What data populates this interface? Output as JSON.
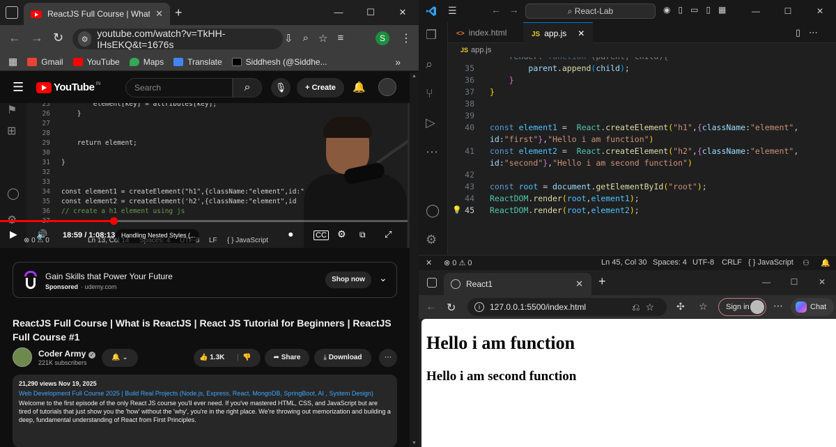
{
  "chrome": {
    "tab_title": "ReactJS Full Course | What is Re",
    "url": "youtube.com/watch?v=TkHH-IHsEKQ&t=1676s",
    "profile_initial": "S",
    "bookmarks": [
      {
        "label": "Gmail",
        "color": "#ea4335"
      },
      {
        "label": "YouTube",
        "color": "#ff0000"
      },
      {
        "label": "Maps",
        "color": "#34a853"
      },
      {
        "label": "Translate",
        "color": "#4285f4"
      },
      {
        "label": "Siddhesh (@Siddhe...",
        "color": "#000000"
      }
    ]
  },
  "youtube": {
    "logo_text": "YouTube",
    "logo_country": "IN",
    "search_placeholder": "Search",
    "create_label": "+ Create",
    "video": {
      "code_lines": [
        {
          "n": "25",
          "t": "        element[key] = attributes[key];"
        },
        {
          "n": "26",
          "t": "    }"
        },
        {
          "n": "27",
          "t": ""
        },
        {
          "n": "28",
          "t": ""
        },
        {
          "n": "29",
          "t": "    return element;"
        },
        {
          "n": "30",
          "t": ""
        },
        {
          "n": "31",
          "t": "}"
        },
        {
          "n": "32",
          "t": ""
        },
        {
          "n": "33",
          "t": ""
        },
        {
          "n": "34",
          "t": "const element1 = createElement(\"h1\",{className:\"element\",id:\""
        },
        {
          "n": "35",
          "t": "const element2 = createElement('h2',{className:\"element\",id"
        },
        {
          "n": "36",
          "t": "// create a h1 element using js"
        },
        {
          "n": "37",
          "t": ""
        }
      ],
      "time": "18:59 / 1:08:13",
      "chapter": "Handling Nested Styles (...",
      "progress": 0.278,
      "status_items": [
        "⊗ 0 ⚠ 0",
        "Ln 13, Col 14",
        "Spaces: 4",
        "UTF-8",
        "LF",
        "{ } JavaScript"
      ]
    },
    "ad": {
      "title": "Gain Skills that Power Your Future",
      "sponsored": "Sponsored",
      "domain": "· udemy.com",
      "cta": "Shop now"
    },
    "title": "ReactJS Full Course | What is ReactJS | React JS Tutorial for Beginners | ReactJS Full Course #1",
    "channel": {
      "name": "Coder Army",
      "subscribers": "221K subscribers"
    },
    "actions": {
      "likes": "1.3K",
      "share": "Share",
      "download": "Download"
    },
    "description": {
      "meta": "21,290 views  Nov 19, 2025",
      "link": "Web Development Full Course 2025 | Build Real Projects (Node.js, Express, React, MongoDB, SpringBoot, AI , System Design)",
      "text": "Welcome to the first episode of the only React JS course you'll ever need. If you've mastered HTML, CSS, and JavaScript but are tired of tutorials that just show you the 'how' without the 'why', you're in the right place. We're throwing out memorization and building a deep, fundamental understanding of React from First Principles."
    }
  },
  "vscode": {
    "search": "React-Lab",
    "tabs": [
      {
        "icon": "<>",
        "label": "index.html",
        "active": false
      },
      {
        "icon": "JS",
        "label": "app.js",
        "active": true
      }
    ],
    "breadcrumb": "app.js",
    "status": {
      "problems": "⊗ 0 ⚠ 0",
      "position": "Ln 45, Col 30",
      "spaces": "Spaces: 4",
      "encoding": "UTF-8",
      "eol": "CRLF",
      "language": "{ } JavaScript"
    }
  },
  "edge": {
    "tab_title": "React1",
    "url": "127.0.0.1:5500/index.html",
    "signin": "Sign in",
    "chat": "Chat",
    "page": {
      "h1": "Hello i am function",
      "h2": "Hello i am second function"
    }
  }
}
